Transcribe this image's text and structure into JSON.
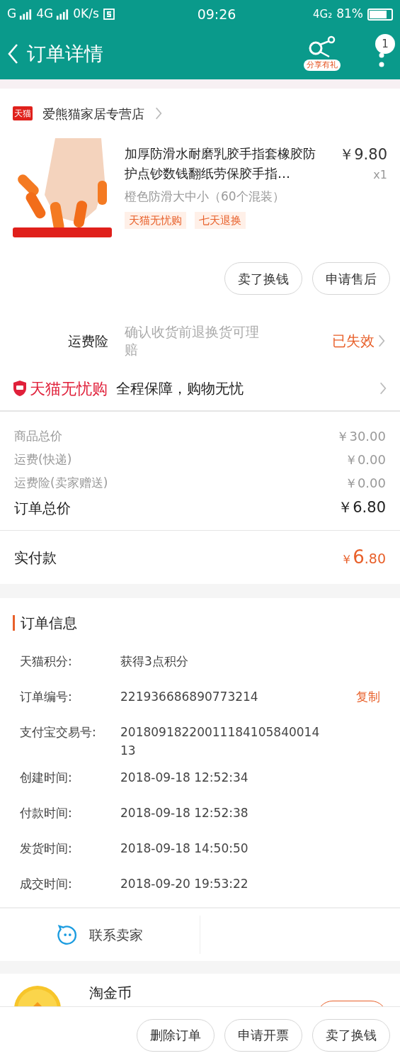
{
  "status_bar": {
    "left": [
      "G",
      "4G",
      "0K/s"
    ],
    "time": "09:26",
    "network": "4G₂",
    "battery": "81%"
  },
  "header": {
    "title": "订单详情",
    "share_badge": "分享有礼",
    "notification_count": "1"
  },
  "store": {
    "name": "爱熊猫家居专营店",
    "badge": "天猫"
  },
  "product": {
    "kind": "picture",
    "title": "加厚防滑水耐磨乳胶手指套橡胶防护点钞数钱翻纸劳保胶手指…",
    "variant": "橙色防滑大中小（60个混装）",
    "price": "￥9.80",
    "quantity": "x1",
    "tags": [
      "天猫无忧购",
      "七天退换"
    ]
  },
  "item_actions": [
    "卖了换钱",
    "申请售后"
  ],
  "insurance": {
    "label": "运费险",
    "description": "确认收货前退换货可理赔",
    "status": "已失效"
  },
  "guarantee": {
    "brand": "天猫无忧购",
    "text": "全程保障，购物无忧"
  },
  "price_lines": [
    {
      "label": "商品总价",
      "value": "￥30.00"
    },
    {
      "label": "运费(快递)",
      "value": "￥0.00"
    },
    {
      "label": "运费险(卖家赠送)",
      "value": "￥0.00"
    }
  ],
  "order_total": {
    "label": "订单总价",
    "value": "￥6.80"
  },
  "paid": {
    "label": "实付款",
    "currency": "￥",
    "integer": "6",
    "decimal": ".80"
  },
  "order_info": {
    "title": "订单信息",
    "rows": [
      {
        "label": "天猫积分:",
        "value": "获得3点积分"
      },
      {
        "label": "订单编号:",
        "value": "221936686890773214",
        "action": "复制"
      },
      {
        "label": "支付宝交易号:",
        "value": "2018091822001118410584001413"
      },
      {
        "label": "创建时间:",
        "value": "2018-09-18 12:52:34"
      },
      {
        "label": "付款时间:",
        "value": "2018-09-18 12:52:38"
      },
      {
        "label": "发货时间:",
        "value": "2018-09-18 14:50:50"
      },
      {
        "label": "成交时间:",
        "value": "2018-09-20 19:53:22"
      }
    ]
  },
  "contact": {
    "label": "联系卖家"
  },
  "coin": {
    "title": "淘金币"
  },
  "bottom_actions": [
    "删除订单",
    "申请开票",
    "卖了换钱"
  ]
}
